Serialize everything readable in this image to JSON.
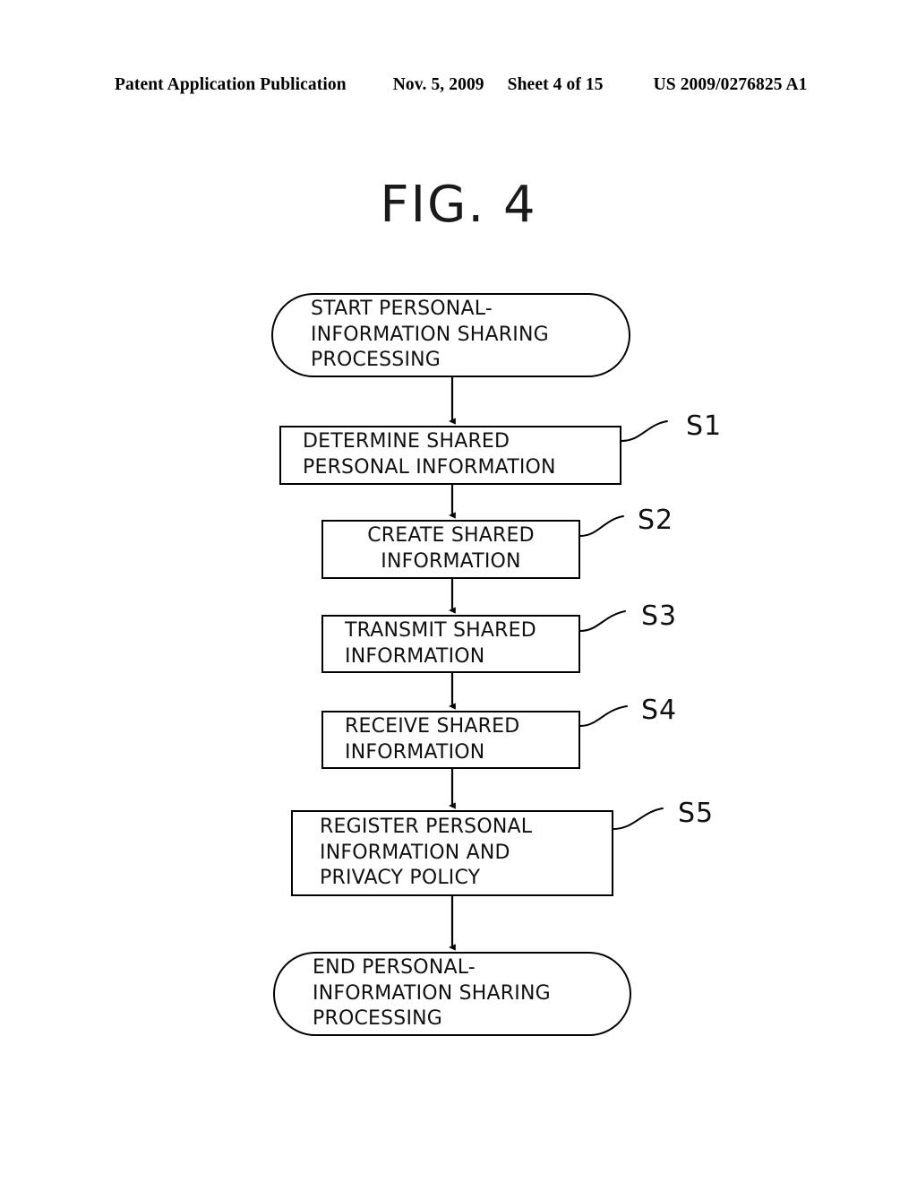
{
  "header": {
    "publication": "Patent Application Publication",
    "date": "Nov. 5, 2009",
    "sheet": "Sheet 4 of 15",
    "patent_number": "US 2009/0276825 A1"
  },
  "figure": {
    "title": "FIG. 4"
  },
  "flowchart": {
    "type": "flowchart",
    "orientation": "top-to-bottom",
    "nodes": [
      {
        "id": "start",
        "shape": "terminator",
        "text": "START PERSONAL-\nINFORMATION SHARING\nPROCESSING",
        "align": "left"
      },
      {
        "id": "s1",
        "shape": "process",
        "text": "DETERMINE SHARED\nPERSONAL INFORMATION",
        "align": "left",
        "ref": "S1"
      },
      {
        "id": "s2",
        "shape": "process",
        "text": "CREATE SHARED\nINFORMATION",
        "align": "center",
        "ref": "S2"
      },
      {
        "id": "s3",
        "shape": "process",
        "text": "TRANSMIT SHARED\nINFORMATION",
        "align": "left",
        "ref": "S3"
      },
      {
        "id": "s4",
        "shape": "process",
        "text": "RECEIVE SHARED\nINFORMATION",
        "align": "left",
        "ref": "S4"
      },
      {
        "id": "s5",
        "shape": "process",
        "text": "REGISTER PERSONAL\nINFORMATION AND\nPRIVACY POLICY",
        "align": "left",
        "ref": "S5"
      },
      {
        "id": "end",
        "shape": "terminator",
        "text": "END PERSONAL-\nINFORMATION SHARING\nPROCESSING",
        "align": "left"
      }
    ],
    "step_labels": {
      "s1": "S1",
      "s2": "S2",
      "s3": "S3",
      "s4": "S4",
      "s5": "S5"
    },
    "connectors": [
      {
        "from": "start",
        "to": "s1",
        "style": "arrow"
      },
      {
        "from": "s1",
        "to": "s2",
        "style": "arrow"
      },
      {
        "from": "s2",
        "to": "s3",
        "style": "arrow"
      },
      {
        "from": "s3",
        "to": "s4",
        "style": "arrow"
      },
      {
        "from": "s4",
        "to": "s5",
        "style": "arrow"
      },
      {
        "from": "s5",
        "to": "end",
        "style": "arrow"
      }
    ],
    "colors": {
      "ink": "#000000",
      "paper": "#ffffff"
    }
  }
}
